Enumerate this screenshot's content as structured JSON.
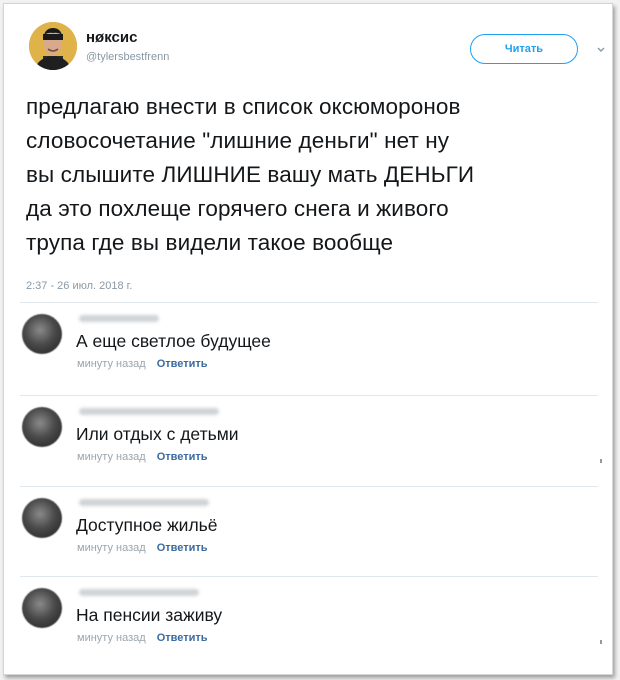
{
  "tweet": {
    "author_name": "нøксис",
    "author_handle": "@tylersbestfrenn",
    "follow_label": "Читать",
    "lines": [
      "предлагаю внести в список оксюморонов",
      "словосочетание \"лишние деньги\" нет ну",
      "вы слышите ЛИШНИЕ вашу мать ДЕНЬГИ",
      "да это похлеще горячего снега и живого",
      "трупа где вы видели такое вообще"
    ],
    "timestamp": "2:37 - 26 июл. 2018 г."
  },
  "comments": [
    {
      "text": "А еще светлое будущее",
      "time": "минуту назад",
      "reply": "Ответить"
    },
    {
      "text": "Или отдых с детьми",
      "time": "минуту назад",
      "reply": "Ответить"
    },
    {
      "text": "Доступное жильё",
      "time": "минуту назад",
      "reply": "Ответить"
    },
    {
      "text": "На пенсии заживу",
      "time": "минуту назад",
      "reply": "Ответить"
    }
  ],
  "icons": {
    "more": "chevron-down-icon"
  },
  "colors": {
    "accent": "#1da1f2",
    "reply_link": "#3b6aa0",
    "muted": "#8899a6"
  }
}
